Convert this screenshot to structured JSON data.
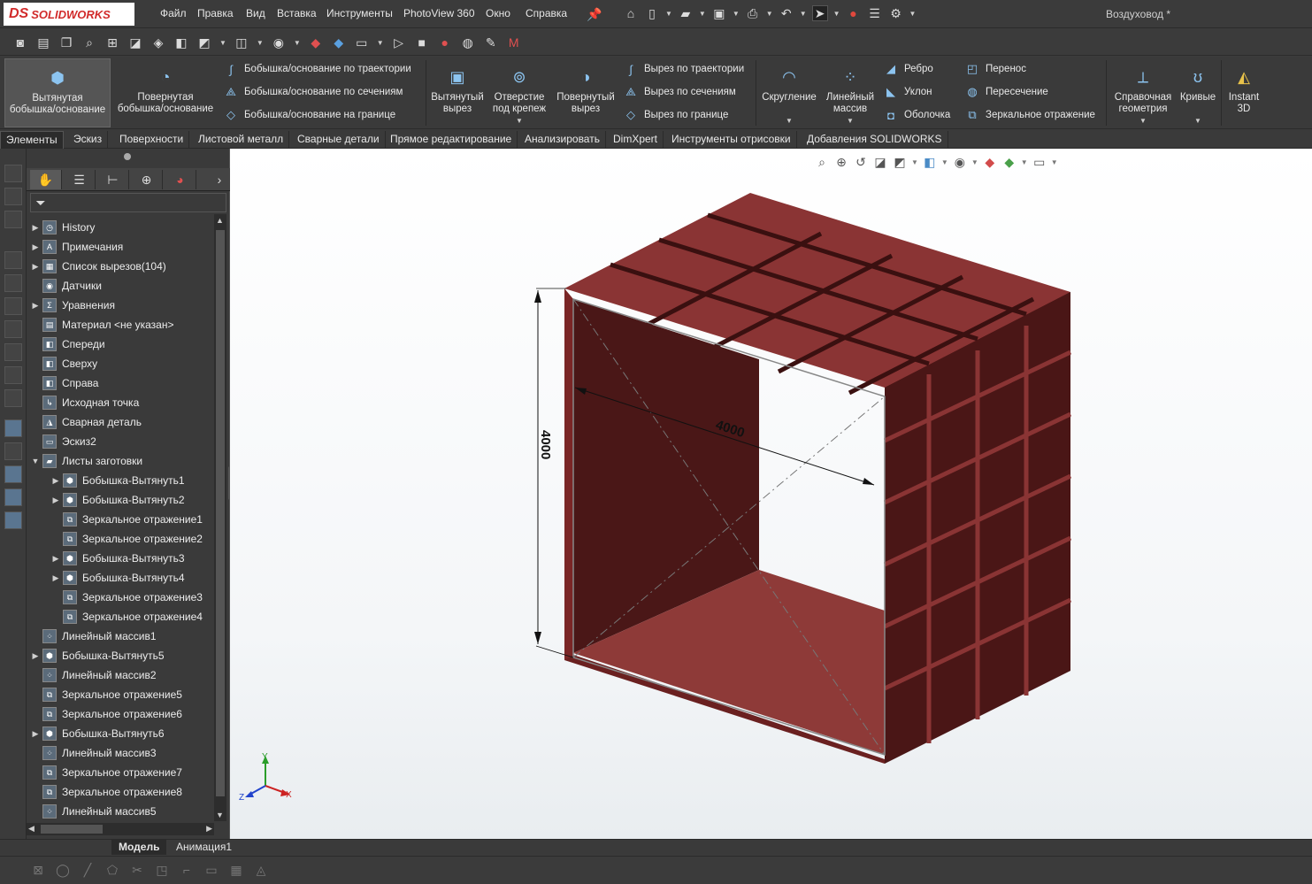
{
  "app": {
    "logo_ds": "DS",
    "logo_name": "SOLIDWORKS",
    "document_title": "Воздуховод *"
  },
  "menu": [
    "Файл",
    "Правка",
    "Вид",
    "Вставка",
    "Инструменты",
    "PhotoView 360",
    "Окно",
    "Справка"
  ],
  "ribbon": {
    "big_left": [
      {
        "label1": "Вытянутая",
        "label2": "бобышка/основание",
        "icon": "extrude-boss-icon"
      },
      {
        "label1": "Повернутая",
        "label2": "бобышка/основание",
        "icon": "revolve-boss-icon"
      }
    ],
    "small_boss": [
      {
        "label": "Бобышка/основание по траектории",
        "icon": "sweep-boss-icon"
      },
      {
        "label": "Бобышка/основание по сечениям",
        "icon": "loft-boss-icon"
      },
      {
        "label": "Бобышка/основание на границе",
        "icon": "boundary-boss-icon"
      }
    ],
    "big_cut": [
      {
        "label1": "Вытянутый",
        "label2": "вырез",
        "icon": "extrude-cut-icon"
      },
      {
        "label1": "Отверстие",
        "label2": "под крепеж",
        "icon": "hole-wizard-icon"
      },
      {
        "label1": "Повернутый",
        "label2": "вырез",
        "icon": "revolve-cut-icon"
      }
    ],
    "small_cut": [
      {
        "label": "Вырез по траектории",
        "icon": "sweep-cut-icon"
      },
      {
        "label": "Вырез по сечениям",
        "icon": "loft-cut-icon"
      },
      {
        "label": "Вырез по границе",
        "icon": "boundary-cut-icon"
      }
    ],
    "big_feat": [
      {
        "label1": "Скругление",
        "label2": "",
        "icon": "fillet-icon"
      },
      {
        "label1": "Линейный",
        "label2": "массив",
        "icon": "linear-pattern-icon"
      }
    ],
    "small_feat1": [
      {
        "label": "Ребро",
        "icon": "rib-icon"
      },
      {
        "label": "Уклон",
        "icon": "draft-icon"
      },
      {
        "label": "Оболочка",
        "icon": "shell-icon"
      }
    ],
    "small_feat2": [
      {
        "label": "Перенос",
        "icon": "wrap-icon"
      },
      {
        "label": "Пересечение",
        "icon": "intersect-icon"
      },
      {
        "label": "Зеркальное отражение",
        "icon": "mirror-icon"
      }
    ],
    "big_right": [
      {
        "label1": "Справочная",
        "label2": "геометрия",
        "icon": "reference-geometry-icon"
      },
      {
        "label1": "Кривые",
        "label2": "",
        "icon": "curves-icon"
      },
      {
        "label1": "Instant",
        "label2": "3D",
        "icon": "instant3d-icon"
      }
    ]
  },
  "command_tabs": [
    "Элементы",
    "Эскиз",
    "Поверхности",
    "Листовой металл",
    "Сварные детали",
    "Прямое редактирование",
    "Анализировать",
    "DimXpert",
    "Инструменты отрисовки",
    "Добавления SOLIDWORKS"
  ],
  "tree": [
    {
      "label": "History",
      "exp": "▶",
      "level": 0,
      "icon": "history-icon"
    },
    {
      "label": "Примечания",
      "exp": "▶",
      "level": 0,
      "icon": "annotations-icon"
    },
    {
      "label": "Список вырезов(104)",
      "exp": "▶",
      "level": 0,
      "icon": "cut-list-icon"
    },
    {
      "label": "Датчики",
      "exp": "",
      "level": 0,
      "icon": "sensors-icon"
    },
    {
      "label": "Уравнения",
      "exp": "▶",
      "level": 0,
      "icon": "equations-icon"
    },
    {
      "label": "Материал <не указан>",
      "exp": "",
      "level": 0,
      "icon": "material-icon"
    },
    {
      "label": "Спереди",
      "exp": "",
      "level": 0,
      "icon": "plane-icon"
    },
    {
      "label": "Сверху",
      "exp": "",
      "level": 0,
      "icon": "plane-icon"
    },
    {
      "label": "Справа",
      "exp": "",
      "level": 0,
      "icon": "plane-icon"
    },
    {
      "label": "Исходная точка",
      "exp": "",
      "level": 0,
      "icon": "origin-icon"
    },
    {
      "label": "Сварная деталь",
      "exp": "",
      "level": 0,
      "icon": "weldment-icon"
    },
    {
      "label": "Эскиз2",
      "exp": "",
      "level": 0,
      "icon": "sketch-icon"
    },
    {
      "label": "Листы заготовки",
      "exp": "▼",
      "level": 0,
      "icon": "folder-icon"
    },
    {
      "label": "Бобышка-Вытянуть1",
      "exp": "▶",
      "level": 1,
      "icon": "extrude-icon"
    },
    {
      "label": "Бобышка-Вытянуть2",
      "exp": "▶",
      "level": 1,
      "icon": "extrude-icon"
    },
    {
      "label": "Зеркальное отражение1",
      "exp": "",
      "level": 1,
      "icon": "mirror-icon"
    },
    {
      "label": "Зеркальное отражение2",
      "exp": "",
      "level": 1,
      "icon": "mirror-icon"
    },
    {
      "label": "Бобышка-Вытянуть3",
      "exp": "▶",
      "level": 1,
      "icon": "extrude-icon"
    },
    {
      "label": "Бобышка-Вытянуть4",
      "exp": "▶",
      "level": 1,
      "icon": "extrude-icon"
    },
    {
      "label": "Зеркальное отражение3",
      "exp": "",
      "level": 1,
      "icon": "mirror-icon"
    },
    {
      "label": "Зеркальное отражение4",
      "exp": "",
      "level": 1,
      "icon": "mirror-icon"
    },
    {
      "label": "Линейный массив1",
      "exp": "",
      "level": 0,
      "icon": "linear-pattern-icon"
    },
    {
      "label": "Бобышка-Вытянуть5",
      "exp": "▶",
      "level": 0,
      "icon": "extrude-icon"
    },
    {
      "label": "Линейный массив2",
      "exp": "",
      "level": 0,
      "icon": "linear-pattern-icon"
    },
    {
      "label": "Зеркальное отражение5",
      "exp": "",
      "level": 0,
      "icon": "mirror-icon"
    },
    {
      "label": "Зеркальное отражение6",
      "exp": "",
      "level": 0,
      "icon": "mirror-icon"
    },
    {
      "label": "Бобышка-Вытянуть6",
      "exp": "▶",
      "level": 0,
      "icon": "extrude-icon"
    },
    {
      "label": "Линейный массив3",
      "exp": "",
      "level": 0,
      "icon": "linear-pattern-icon"
    },
    {
      "label": "Зеркальное отражение7",
      "exp": "",
      "level": 0,
      "icon": "mirror-icon"
    },
    {
      "label": "Зеркальное отражение8",
      "exp": "",
      "level": 0,
      "icon": "mirror-icon"
    },
    {
      "label": "Линейный массив5",
      "exp": "",
      "level": 0,
      "icon": "linear-pattern-icon"
    }
  ],
  "bottom_tabs": [
    "Модель",
    "Анимация1"
  ],
  "viewport": {
    "dim_vertical": "4000",
    "dim_horizontal": "4000",
    "triad_x": "X",
    "triad_y": "Y",
    "triad_z": "Z",
    "part_color": "#7a2626",
    "part_dark": "#4a1717",
    "part_mid": "#8e3a38"
  }
}
